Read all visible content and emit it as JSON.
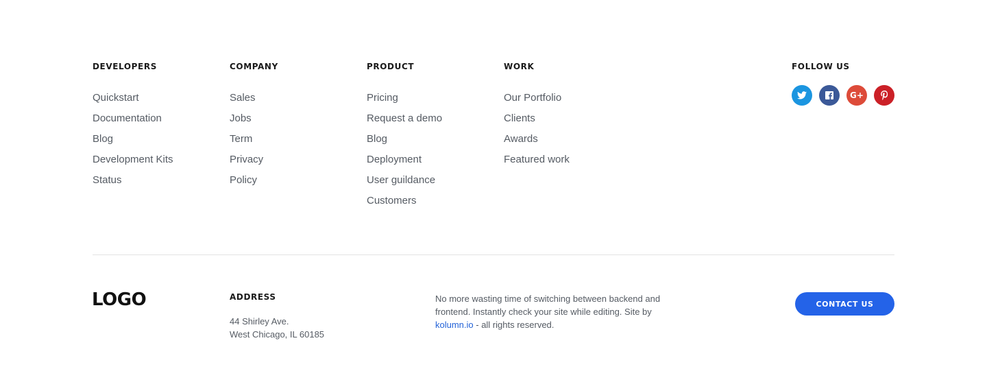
{
  "columns": [
    {
      "title": "DEVELOPERS",
      "links": [
        "Quickstart",
        "Documentation",
        "Blog",
        "Development Kits",
        "Status"
      ]
    },
    {
      "title": "COMPANY",
      "links": [
        "Sales",
        "Jobs",
        "Term",
        "Privacy",
        "Policy"
      ]
    },
    {
      "title": "PRODUCT",
      "links": [
        "Pricing",
        "Request a demo",
        "Blog",
        "Deployment",
        "User guildance",
        "Customers"
      ]
    },
    {
      "title": "WORK",
      "links": [
        "Our Portfolio",
        "Clients",
        "Awards",
        "Featured work"
      ]
    }
  ],
  "follow": {
    "title": "FOLLOW US",
    "icons": [
      {
        "name": "twitter-icon",
        "glyph": "t",
        "color": "#1b95e0"
      },
      {
        "name": "facebook-icon",
        "glyph": "f",
        "color": "#3b5998"
      },
      {
        "name": "google-plus-icon",
        "glyph": "G+",
        "color": "#dd4b39"
      },
      {
        "name": "pinterest-icon",
        "glyph": "p",
        "color": "#cb2027"
      }
    ]
  },
  "logo": "LOGO",
  "address": {
    "title": "ADDRESS",
    "line1": "44 Shirley Ave.",
    "line2": "West Chicago, IL 60185"
  },
  "blurb": {
    "text_before": "No more wasting time of switching between backend and frontend. Instantly check your site while editing. Site by ",
    "link": "kolumn.io",
    "text_after": " - all rights reserved."
  },
  "contact_button": {
    "label": "CONTACT US",
    "color": "#2463e8"
  }
}
